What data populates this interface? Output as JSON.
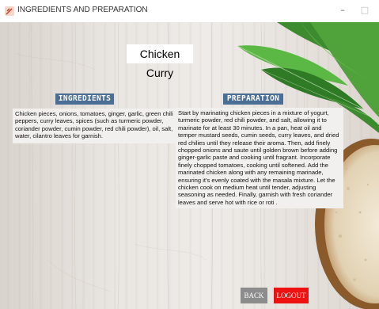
{
  "window": {
    "title": "INGREDIENTS AND PREPARATION",
    "minimize_symbol": "–",
    "maximize_symbol": "□",
    "icon": "app-feather-icon"
  },
  "page": {
    "heading": "Chicken Curry"
  },
  "ingredients": {
    "header": "INGREDIENTS",
    "text": "Chicken pieces, onions, tomatoes, ginger, garlic, green chili peppers, curry leaves, spices (such as turmeric powder, coriander powder, cumin powder, red chili powder), oil, salt, water, cilantro leaves for garnish."
  },
  "preparation": {
    "header": "PREPARATION",
    "text": "Start by marinating chicken pieces in a mixture of yogurt, turmeric powder, red chili powder, and salt, allowing it to marinate for at least 30 minutes. In a pan, heat oil and temper mustard seeds, cumin seeds, curry leaves, and dried red chilies until they release their aroma. Then, add finely chopped onions and saute until golden brown before adding ginger-garlic paste and cooking until fragrant. Incorporate finely chopped tomatoes, cooking until softened. Add the marinated chicken along with any remaining marinade, ensuring it's evenly coated with the masala mixture. Let the chicken cook on medium heat until tender, adjusting seasoning as needed. Finally, garnish with fresh coriander leaves and serve hot with rice or roti ."
  },
  "buttons": {
    "back": "BACK",
    "logout": "LOGOUT"
  },
  "colors": {
    "section_header_bg": "#4a6e96",
    "back_button_bg": "#8c8c8c",
    "logout_button_bg": "#ee1111",
    "text_box_bg": "#f2f0ee"
  }
}
